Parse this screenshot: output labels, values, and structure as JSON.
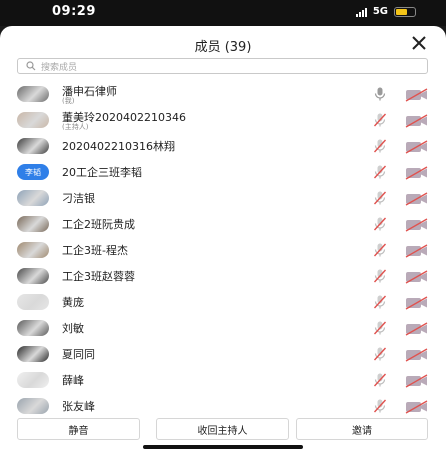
{
  "status": {
    "time": "09:29",
    "network": "5G"
  },
  "header": {
    "title": "成员 (39)"
  },
  "search": {
    "placeholder": "搜索成员"
  },
  "members": [
    {
      "name": "潘申石律师",
      "sub": "(我)",
      "avatar": "photo",
      "mic": "on"
    },
    {
      "name": "董美玲2020402210346",
      "sub": "(主持人)",
      "avatar": "photo",
      "mic": "muted"
    },
    {
      "name": "2020402210316林翔",
      "avatar": "photo",
      "mic": "muted"
    },
    {
      "name": "20工企三班李韬",
      "avatar": "text",
      "avatar_text": "李韬",
      "mic": "muted"
    },
    {
      "name": "刁洁银",
      "avatar": "photo",
      "mic": "muted"
    },
    {
      "name": "工企2班阮贵成",
      "avatar": "photo",
      "mic": "muted"
    },
    {
      "name": "工企3班-程杰",
      "avatar": "photo",
      "mic": "muted"
    },
    {
      "name": "工企3班赵蓉蓉",
      "avatar": "photo",
      "mic": "muted"
    },
    {
      "name": "黄庞",
      "avatar": "photo",
      "mic": "muted"
    },
    {
      "name": "刘敏",
      "avatar": "photo",
      "mic": "muted"
    },
    {
      "name": "夏同同",
      "avatar": "photo",
      "mic": "muted"
    },
    {
      "name": "薛峰",
      "avatar": "photo",
      "mic": "muted"
    },
    {
      "name": "张友峰",
      "avatar": "photo",
      "mic": "muted"
    }
  ],
  "footer": {
    "mute_label": "静音",
    "reclaim_host_label": "收回主持人",
    "invite_label": "邀请"
  },
  "colors": {
    "accent": "#2f7fe8",
    "muted_mic": "#e0524f",
    "camera_off": "#8e6b8a"
  }
}
